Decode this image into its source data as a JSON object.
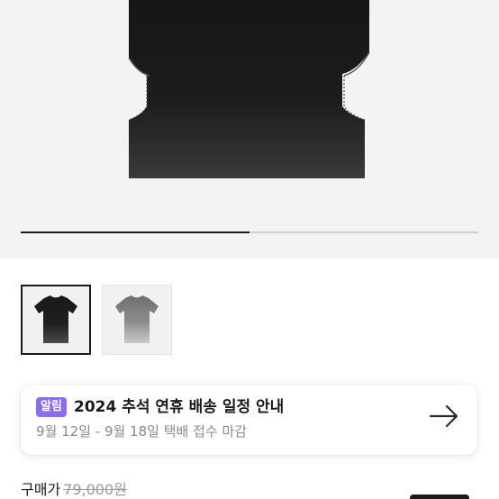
{
  "gallery": {
    "main_image": "black-tshirt-back-faded-hem",
    "progress_fraction": 0.5
  },
  "thumbnails": [
    {
      "image": "black-tshirt-faded",
      "selected": true
    },
    {
      "image": "grey-tshirt-faded",
      "selected": false
    }
  ],
  "notice": {
    "badge": "알림",
    "title": "2024 추석 연휴 배송 일정 안내",
    "subtitle": "9월 12일 - 9월 18일 택배 접수 마감",
    "arrow_icon": "arrow-right-icon"
  },
  "price": {
    "label": "구매가",
    "original": "79,000원"
  },
  "colors": {
    "accent_badge": "#8b6cf0",
    "text_primary": "#1a1a1a",
    "text_muted": "#8a8a8a"
  }
}
